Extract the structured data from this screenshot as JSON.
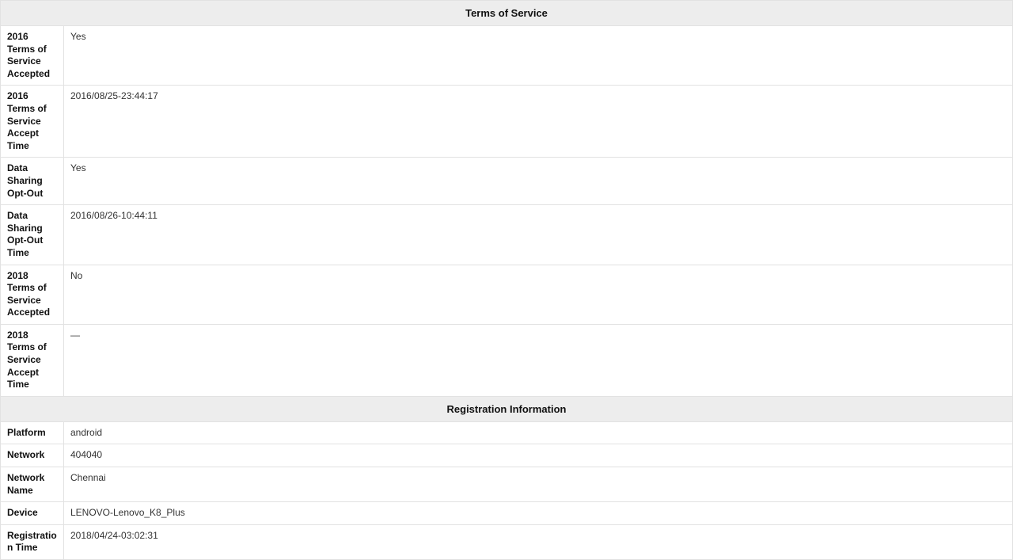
{
  "sections": [
    {
      "title": "Terms of Service",
      "rows": [
        {
          "label": "2016 Terms of Service Accepted",
          "value": "Yes"
        },
        {
          "label": "2016 Terms of Service Accept Time",
          "value": "2016/08/25-23:44:17"
        },
        {
          "label": "Data Sharing Opt-Out",
          "value": "Yes"
        },
        {
          "label": "Data Sharing Opt-Out Time",
          "value": "2016/08/26-10:44:11"
        },
        {
          "label": "2018 Terms of Service Accepted",
          "value": "No"
        },
        {
          "label": "2018 Terms of Service Accept Time",
          "value": "—"
        }
      ]
    },
    {
      "title": "Registration Information",
      "rows": [
        {
          "label": "Platform",
          "value": "android"
        },
        {
          "label": "Network",
          "value": "404040"
        },
        {
          "label": "Network Name",
          "value": "Chennai"
        },
        {
          "label": "Device",
          "value": "LENOVO-Lenovo_K8_Plus"
        },
        {
          "label": "Registration Time",
          "value": "2018/04/24-03:02:31"
        }
      ]
    }
  ]
}
